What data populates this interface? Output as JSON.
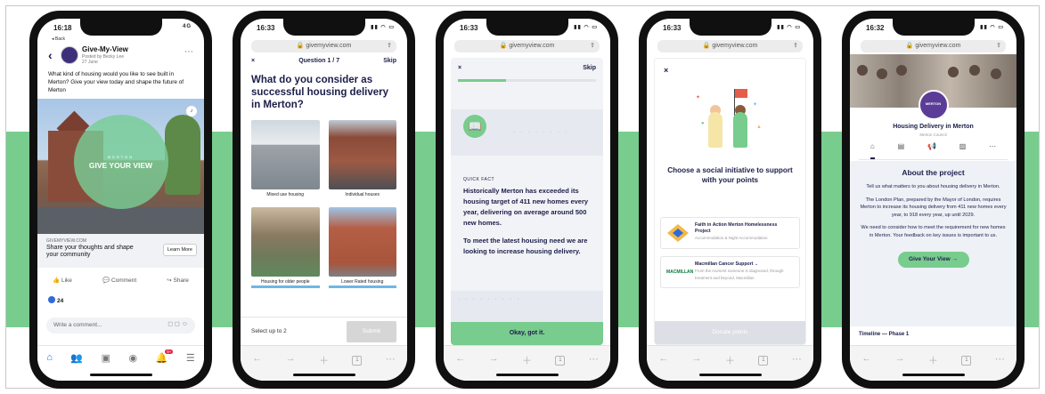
{
  "colors": {
    "brand_green": "#78cc8e",
    "navy": "#1c1e4a",
    "fb_blue": "#1a6ed8"
  },
  "phone1": {
    "time": "16:18",
    "status_icons": "4G",
    "back": "◂ Back",
    "page_name": "Give-My-View",
    "meta_line1": "Posted by Becky Lee",
    "meta_line2": "27 June",
    "post_text": "What kind of housing would you like to see built in Merton? Give your view today and shape the future of Merton",
    "circle_small": "MERTON",
    "circle_big": "GIVE YOUR VIEW",
    "link_domain": "GIVEMYVIEW.COM",
    "link_title": "Share your thoughts and shape your community",
    "learn_more": "Learn More",
    "like": "Like",
    "comment": "Comment",
    "share": "Share",
    "reaction_count": "24",
    "comment_placeholder": "Write a comment...",
    "notif_badge": "9+"
  },
  "phone2": {
    "time": "16:33",
    "url": "givemyview.com",
    "close": "×",
    "progress": "Question 1 / 7",
    "skip": "Skip",
    "question": "What do you consider as successful housing delivery in Merton?",
    "options": [
      "Mixed use housing",
      "Individual houses",
      "Housing for older people",
      "Lower Rated housing"
    ],
    "select_hint": "Select up to 2",
    "submit": "Submit"
  },
  "phone3": {
    "time": "16:33",
    "url": "givemyview.com",
    "close": "×",
    "skip": "Skip",
    "progress_fraction": 0.35,
    "fact_label": "QUICK FACT",
    "fact_p1": "Historically Merton has exceeded its housing target of 411 new homes every year, delivering on average around 500 new homes.",
    "fact_p2": "To meet the latest housing need we are looking to increase housing delivery.",
    "okay": "Okay, got it."
  },
  "phone4": {
    "time": "16:33",
    "url": "givemyview.com",
    "close": "×",
    "heading": "Choose a social initiative to support with your points",
    "org1_name": "Faith in Action Merton Homelessness Project",
    "org1_sub": "Accommodation & Night Accommodation",
    "org2_name": "Macmillan Cancer Support",
    "org2_sub": "From the moment someone is diagnosed, through treatment and beyond, Macmillan",
    "org2_logo": "MACMILLAN",
    "donate": "Donate points"
  },
  "phone5": {
    "time": "16:32",
    "url": "givemyview.com",
    "logo_text": "MERTON",
    "title": "Housing Delivery in Merton",
    "subtitle": "Merton Council",
    "about_heading": "About the project",
    "about_p1": "Tell us what matters to you about housing delivery in Merton.",
    "about_p2": "The London Plan, prepared by the Mayor of London, requires Merton to increase its housing delivery from 411 new homes every year, to 918 every year, up until 2029.",
    "about_p3": "We need to consider how to meet the requirement for new homes in Merton. Your feedback on key issues is important to us.",
    "cta": "Give Your View →",
    "timeline": "Timeline — Phase 1"
  }
}
